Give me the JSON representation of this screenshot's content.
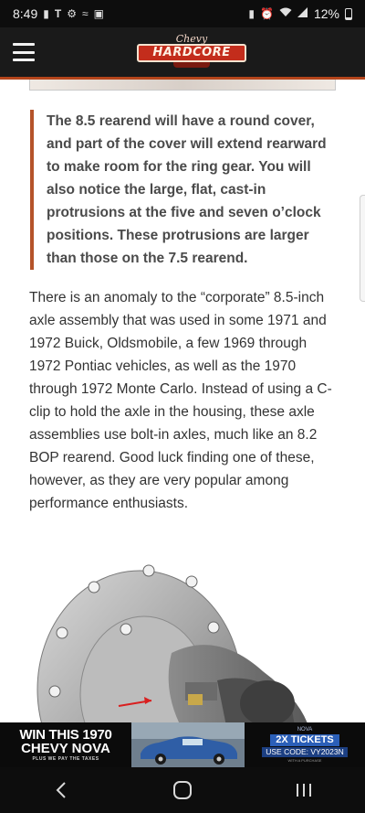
{
  "status_bar": {
    "time": "8:49",
    "left_icons": [
      "lock-icon",
      "t-mobile-icon",
      "settings-icon",
      "nfc-icon",
      "gallery-icon"
    ],
    "right_icons": [
      "lock-icon",
      "alarm-icon",
      "wifi-icon",
      "signal-icon"
    ],
    "battery": "12%"
  },
  "header": {
    "logo_top": "Chevy",
    "logo_main": "HARDCORE",
    "menu_icon": "hamburger-icon",
    "colors": {
      "background": "#1a1a1a",
      "accent": "#b5451b",
      "logo_red": "#c32d1c"
    }
  },
  "article": {
    "quote": "The 8.5 rearend will have a round cover, and part of the cover will extend rearward to make room for the ring gear. You will also notice the large, flat, cast-in protrusions at the five and seven o’clock positions. These protrusions are larger than those on the 7.5 rearend.",
    "paragraph": "There is an anomaly to the “corporate” 8.5-inch axle assembly that was used in some 1971 and 1972 Buick, Oldsmobile, a few 1969 through 1972 Pontiac vehicles, as well as the 1970 through 1972 Monte Carlo. Instead of using a C-clip to hold the axle in the housing, these axle assemblies use bolt-in axles, much like an 8.2 BOP rearend. Good luck finding one of these, however, as they are very popular among performance enthusiasts."
  },
  "ad": {
    "line1": "WIN THIS 1970",
    "line2": "CHEVY NOVA",
    "line3": "PLUS WE PAY THE TAXES",
    "badge": "NOVA",
    "tickets": "2X TICKETS",
    "code": "USE CODE: VY2023N",
    "fine_print": "WITH A PURCHASE"
  },
  "nav": {
    "back_icon": "back-icon",
    "home_icon": "home-icon",
    "recents_icon": "recents-icon"
  }
}
